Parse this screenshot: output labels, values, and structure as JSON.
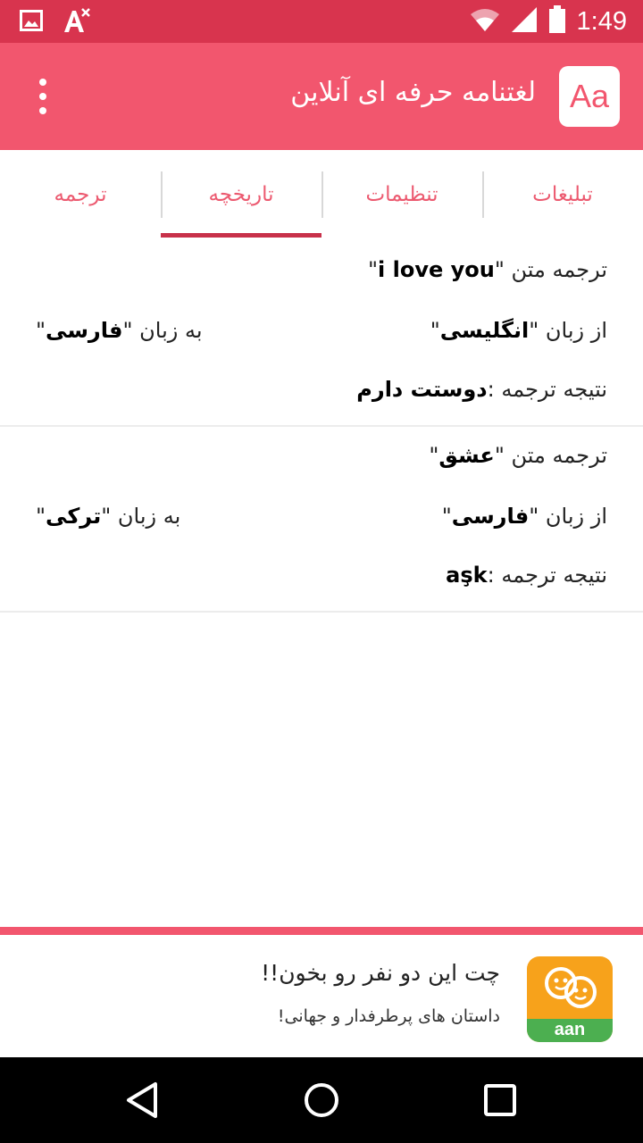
{
  "status_bar": {
    "time": "1:49",
    "icons": [
      "image-icon",
      "font-icon",
      "wifi-icon",
      "signal-icon",
      "battery-icon"
    ]
  },
  "app_bar": {
    "title": "لغتنامه حرفه ای آنلاین",
    "logo_text": "Aa",
    "menu_icon": "more-vert-icon"
  },
  "tabs": [
    {
      "label": "تبلیغات",
      "active": false
    },
    {
      "label": "تنظیمات",
      "active": false
    },
    {
      "label": "تاریخچه",
      "active": true
    },
    {
      "label": "ترجمه",
      "active": false
    }
  ],
  "history": [
    {
      "text_prefix": "ترجمه متن",
      "text": "i love you",
      "from_prefix": "از زبان",
      "from_lang": "انگلیسی",
      "to_prefix": "به زبان",
      "to_lang": "فارسی",
      "result_prefix": "نتیجه ترجمه :",
      "result": "دوستت دارم"
    },
    {
      "text_prefix": "ترجمه متن",
      "text": "عشق",
      "from_prefix": "از زبان",
      "from_lang": "فارسی",
      "to_prefix": "به زبان",
      "to_lang": "ترکی",
      "result_prefix": "نتیجه ترجمه :",
      "result": "aşk"
    }
  ],
  "ad": {
    "title": "چت این دو نفر رو بخون!!",
    "subtitle": "داستان های پرطرفدار و جهانی!",
    "icon_label": "aan"
  },
  "colors": {
    "status_bar": "#d8344e",
    "app_bar": "#f2566e",
    "tab_text": "#ec5a70",
    "tab_indicator": "#c8314a"
  }
}
